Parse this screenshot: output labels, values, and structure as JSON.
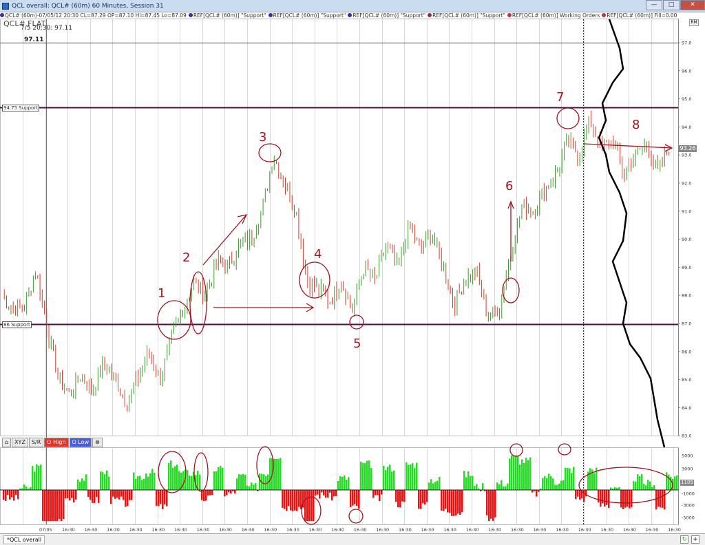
{
  "window": {
    "title": "QCL overall: QCL# (60m) 60 Minutes, Session 31",
    "minimize_glyph": "—",
    "maximize_glyph": "□",
    "close_glyph": "✕"
  },
  "infobar": {
    "items": [
      {
        "text": "QCL# (60m)-07/05/12 20:30 CL=87.29 OP=87.10 Hi=87.45 Lo=87.09",
        "color": "#3b2aa0"
      },
      {
        "text": "REF[QCL# (60m)] \"Support\"",
        "color": "#3b2aa0"
      },
      {
        "text": "REF[QCL# (60m)] \"Support\"",
        "color": "#3b2aa0"
      },
      {
        "text": "REF[QCL# (60m)] \"Support\"",
        "color": "#3b2aa0"
      },
      {
        "text": "REF[QCL# (60m)] \"Support\"",
        "color": "#8a2a5a"
      },
      {
        "text": "REF[QCL# (60m)] Working Orders",
        "color": "#c0304a"
      },
      {
        "text": "REF[QCL# (60m)] Fill=0.00",
        "color": "#c0304a"
      }
    ]
  },
  "symbol_label": "QCL# FLAT",
  "price_label_1": "7/5 20:30: 97.11",
  "price_label_2": "97.11",
  "rm_button": "RM",
  "support_lines": [
    {
      "label": "94.75 Support",
      "price": 94.75
    },
    {
      "label": "86 Support",
      "price": 86.9
    }
  ],
  "last_price": "93.26",
  "indicator_badge": "1105",
  "toolbar": {
    "buttons": [
      {
        "label": "⌂",
        "style": "plain",
        "name": "home-icon"
      },
      {
        "label": "XYZ",
        "style": "plain",
        "name": "xyz-button"
      },
      {
        "label": "S/R",
        "style": "plain",
        "name": "sr-button"
      },
      {
        "label": "O High",
        "style": "red",
        "name": "o-high-button"
      },
      {
        "label": "O Low",
        "style": "blue",
        "name": "o-low-button"
      },
      {
        "label": "⊗",
        "style": "plain",
        "name": "settings-icon"
      }
    ]
  },
  "tabs": {
    "overall": "*QCL overall"
  },
  "zoom_glyph": "↻",
  "plus_glyph": "+",
  "price_axis": {
    "ticks": [
      "97.0",
      "96.0",
      "95.0",
      "94.0",
      "93.0",
      "92.0",
      "91.0",
      "90.0",
      "89.0",
      "88.0",
      "87.0",
      "86.0",
      "85.0",
      "84.0",
      "83.0"
    ]
  },
  "indicator_axis": {
    "ticks": [
      "5000",
      "3000",
      "1000",
      "-1000",
      "-3000",
      "-5000"
    ]
  },
  "time_axis": {
    "labels": [
      "07/05",
      "16:30",
      "16:30",
      "16:30",
      "16:30",
      "16:30",
      "16:30",
      "16:30",
      "16:30",
      "16:30",
      "16:30",
      "16:30",
      "16:30",
      "16:30",
      "16:30",
      "16:30",
      "16:30",
      "16:30",
      "16:30",
      "16:30",
      "16:30",
      "16:30",
      "16:30",
      "16:30",
      "16:30",
      "16:30",
      "16:30",
      "16:30",
      "16:30",
      "16:30",
      "16:30"
    ]
  },
  "annotations": {
    "numbers": [
      "1",
      "2",
      "3",
      "4",
      "5",
      "6",
      "7",
      "8"
    ]
  },
  "colors": {
    "up": "#3a9a2a",
    "down": "#d93a2a",
    "support": "#4a1040",
    "ink": "#a0141e",
    "hist_pos": "#22dd22",
    "hist_neg": "#ee1111"
  },
  "chart_data": {
    "type": "line",
    "series": [
      {
        "x": [
          0,
          5,
          10,
          15,
          20,
          25,
          30,
          35,
          40,
          45,
          50,
          55,
          60,
          65,
          70,
          75,
          80,
          85,
          90,
          95,
          100,
          105,
          110,
          115,
          120,
          125,
          130,
          135,
          140,
          145,
          150,
          155,
          160,
          165,
          170,
          175,
          180,
          185,
          190,
          195,
          200,
          205,
          210,
          215,
          220,
          225,
          230,
          235,
          240,
          245,
          250,
          255,
          260,
          265,
          270,
          275,
          280,
          285,
          290,
          295
        ],
        "values": [
          88.0,
          87.5,
          87.6,
          88.9,
          86.8,
          85.0,
          84.5,
          85.2,
          84.6,
          85.6,
          85.0,
          84.2,
          85.0,
          86.0,
          85.0,
          86.5,
          87.5,
          88.5,
          88.0,
          89.2,
          89.0,
          89.8,
          90.0,
          91.0,
          93.0,
          92.0,
          91.0,
          88.5,
          88.2,
          87.8,
          88.5,
          87.5,
          89.0,
          88.5,
          89.8,
          89.0,
          90.5,
          89.6,
          90.2,
          89.0,
          87.7,
          88.6,
          88.8,
          87.2,
          87.6,
          89.5,
          91.2,
          91.0,
          91.8,
          92.3,
          93.5,
          93.0,
          94.2,
          93.3,
          93.5,
          92.3,
          93.0,
          93.4,
          92.4,
          93.2
        ]
      }
    ],
    "ylim": [
      82.5,
      97.5
    ]
  }
}
